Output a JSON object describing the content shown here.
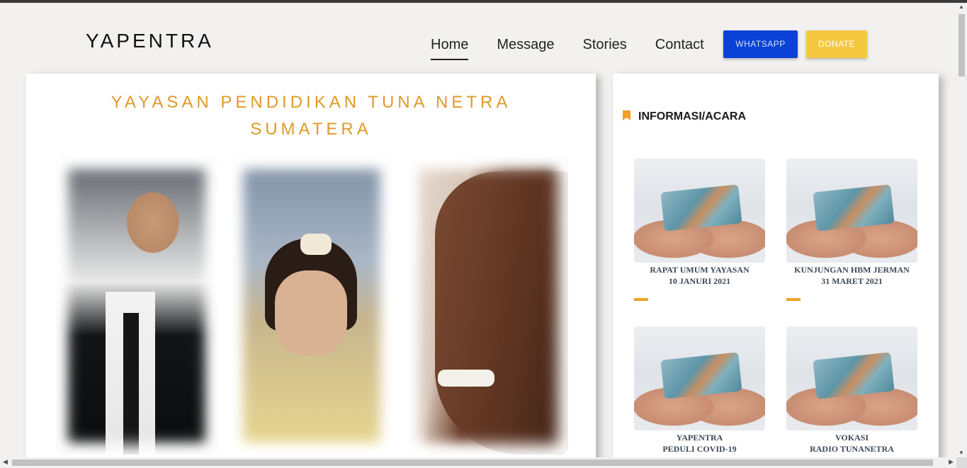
{
  "header": {
    "logo": "YAPENTRA",
    "nav": [
      {
        "label": "Home",
        "active": true
      },
      {
        "label": "Message",
        "active": false
      },
      {
        "label": "Stories",
        "active": false
      },
      {
        "label": "Contact",
        "active": false
      }
    ],
    "whatsapp_label": "WHATSAPP",
    "donate_label": "DONATE"
  },
  "main": {
    "title_line1": "YAYASAN PENDIDIKAN TUNA NETRA",
    "title_line2": "SUMATERA"
  },
  "side": {
    "heading": "INFORMASI/ACARA",
    "cards": [
      {
        "line1": "RAPAT UMUM YAYASAN",
        "line2": "10 JANURI 2021"
      },
      {
        "line1": "KUNJUNGAN HBM JERMAN",
        "line2": "31 MARET 2021"
      },
      {
        "line1": "YAPENTRA",
        "line2": "PEDULI COVID-19"
      },
      {
        "line1": "VOKASI",
        "line2": "RADIO TUNANETRA"
      }
    ]
  },
  "colors": {
    "accent": "#e09a2a",
    "whatsapp": "#0a41d6",
    "donate": "#f5c842",
    "background": "#f2f1ef"
  }
}
